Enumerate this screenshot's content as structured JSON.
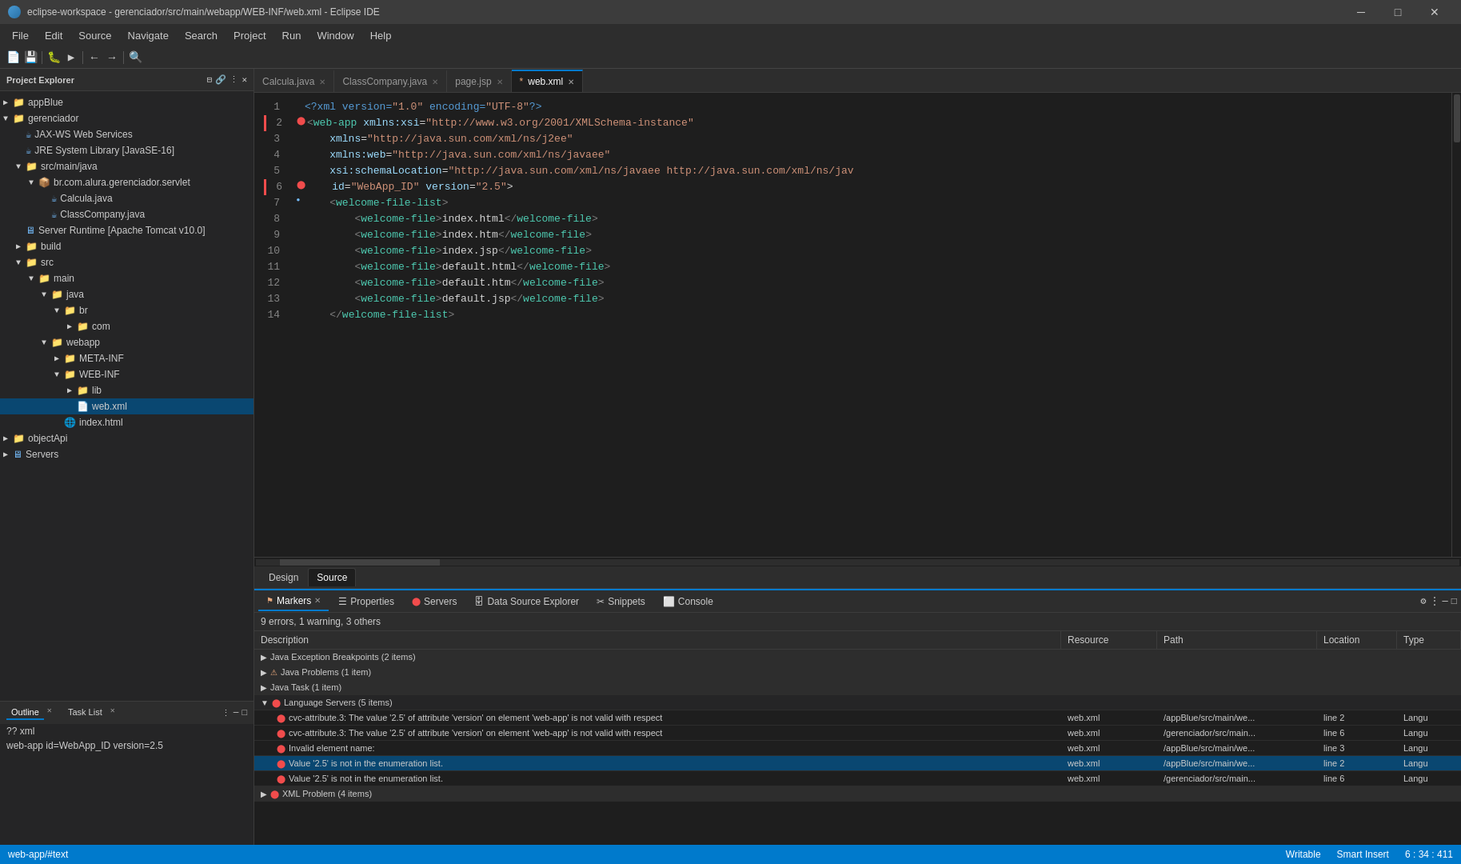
{
  "titleBar": {
    "icon": "eclipse-icon",
    "title": "eclipse-workspace - gerenciador/src/main/webapp/WEB-INF/web.xml - Eclipse IDE",
    "minimize": "─",
    "maximize": "□",
    "close": "✕"
  },
  "menuBar": {
    "items": [
      "File",
      "Edit",
      "Source",
      "Navigate",
      "Search",
      "Project",
      "Run",
      "Window",
      "Help"
    ]
  },
  "editorTabs": [
    {
      "label": "Calcula.java",
      "active": false,
      "modified": false
    },
    {
      "label": "ClassCompany.java",
      "active": false,
      "modified": false
    },
    {
      "label": "page.jsp",
      "active": false,
      "modified": false
    },
    {
      "label": "*web.xml",
      "active": true,
      "modified": true
    }
  ],
  "designerTabs": [
    {
      "label": "Design",
      "active": false
    },
    {
      "label": "Source",
      "active": true
    }
  ],
  "codeLines": [
    {
      "num": 1,
      "code": "<?xml version=\"1.0\" encoding=\"UTF-8\"?>",
      "type": "decl",
      "gutter": ""
    },
    {
      "num": 2,
      "code": "<web-app xmlns:xsi=\"http://www.w3.org/2001/XMLSchema-instance\"",
      "type": "tag",
      "gutter": "error"
    },
    {
      "num": 3,
      "code": "    xmlns=\"http://java.sun.com/xml/ns/j2ee\"",
      "type": "attr",
      "gutter": ""
    },
    {
      "num": 4,
      "code": "    xmlns:web=\"http://java.sun.com/xml/ns/javaee\"",
      "type": "attr",
      "gutter": ""
    },
    {
      "num": 5,
      "code": "    xsi:schemaLocation=\"http://java.sun.com/xml/ns/javaee  http://java.sun.com/xml/ns/jav",
      "type": "attr",
      "gutter": ""
    },
    {
      "num": 6,
      "code": "    id=\"WebApp_ID\"  version=\"2.5\">",
      "type": "attr",
      "gutter": "error"
    },
    {
      "num": 7,
      "code": "    <welcome-file-list>",
      "type": "tag",
      "gutter": "dot"
    },
    {
      "num": 8,
      "code": "        <welcome-file>index.html</welcome-file>",
      "type": "tag",
      "gutter": ""
    },
    {
      "num": 9,
      "code": "        <welcome-file>index.htm</welcome-file>",
      "type": "tag",
      "gutter": ""
    },
    {
      "num": 10,
      "code": "        <welcome-file>index.jsp</welcome-file>",
      "type": "tag",
      "gutter": ""
    },
    {
      "num": 11,
      "code": "        <welcome-file>default.html</welcome-file>",
      "type": "tag",
      "gutter": ""
    },
    {
      "num": 12,
      "code": "        <welcome-file>default.htm</welcome-file>",
      "type": "tag",
      "gutter": ""
    },
    {
      "num": 13,
      "code": "        <welcome-file>default.jsp</welcome-file>",
      "type": "tag",
      "gutter": ""
    },
    {
      "num": 14,
      "code": "    </welcome-file-list>",
      "type": "tag",
      "gutter": ""
    }
  ],
  "projectExplorer": {
    "title": "Project Explorer",
    "closeBtn": "✕",
    "items": [
      {
        "label": "appBlue",
        "level": 0,
        "type": "project",
        "expanded": false
      },
      {
        "label": "gerenciador",
        "level": 0,
        "type": "project",
        "expanded": true
      },
      {
        "label": "JAX-WS Web Services",
        "level": 1,
        "type": "jar",
        "expanded": false
      },
      {
        "label": "JRE System Library [JavaSE-16]",
        "level": 1,
        "type": "jar",
        "expanded": false
      },
      {
        "label": "src/main/java",
        "level": 1,
        "type": "folder",
        "expanded": true
      },
      {
        "label": "br.com.alura.gerenciador.servlet",
        "level": 2,
        "type": "package",
        "expanded": true
      },
      {
        "label": "Calcula.java",
        "level": 3,
        "type": "java",
        "expanded": false
      },
      {
        "label": "ClassCompany.java",
        "level": 3,
        "type": "java",
        "expanded": false
      },
      {
        "label": "Server Runtime [Apache Tomcat v10.0]",
        "level": 1,
        "type": "server",
        "expanded": false
      },
      {
        "label": "build",
        "level": 1,
        "type": "folder",
        "expanded": false
      },
      {
        "label": "src",
        "level": 1,
        "type": "folder",
        "expanded": true
      },
      {
        "label": "main",
        "level": 2,
        "type": "folder",
        "expanded": true
      },
      {
        "label": "java",
        "level": 3,
        "type": "folder",
        "expanded": true
      },
      {
        "label": "br",
        "level": 4,
        "type": "folder",
        "expanded": true
      },
      {
        "label": "com",
        "level": 5,
        "type": "folder",
        "expanded": false
      },
      {
        "label": "webapp",
        "level": 3,
        "type": "folder",
        "expanded": true
      },
      {
        "label": "META-INF",
        "level": 4,
        "type": "folder",
        "expanded": false
      },
      {
        "label": "WEB-INF",
        "level": 4,
        "type": "folder",
        "expanded": true
      },
      {
        "label": "lib",
        "level": 5,
        "type": "folder",
        "expanded": false
      },
      {
        "label": "web.xml",
        "level": 5,
        "type": "xml",
        "expanded": false
      },
      {
        "label": "index.html",
        "level": 4,
        "type": "html",
        "expanded": false
      },
      {
        "label": "objectApi",
        "level": 0,
        "type": "project",
        "expanded": false
      },
      {
        "label": "Servers",
        "level": 0,
        "type": "project",
        "expanded": false
      }
    ]
  },
  "outline": {
    "title": "Outline",
    "taskListTitle": "Task List",
    "closeBtn": "✕",
    "items": [
      {
        "label": "?? xml",
        "level": 0
      },
      {
        "label": "web-app id=WebApp_ID version=2.5",
        "level": 0
      }
    ]
  },
  "problemsPanel": {
    "summary": "9 errors, 1 warning, 3 others",
    "tabs": [
      {
        "label": "Markers",
        "active": true,
        "closeable": true
      },
      {
        "label": "Properties",
        "active": false
      },
      {
        "label": "Servers",
        "active": false
      },
      {
        "label": "Data Source Explorer",
        "active": false
      },
      {
        "label": "Snippets",
        "active": false
      },
      {
        "label": "Console",
        "active": false
      }
    ],
    "columns": [
      "Description",
      "Resource",
      "Path",
      "Location",
      "Type"
    ],
    "categories": [
      {
        "label": "Java Exception Breakpoints (2 items)",
        "expanded": false,
        "type": "info"
      },
      {
        "label": "Java Problems (1 item)",
        "expanded": false,
        "type": "warning"
      },
      {
        "label": "Java Task (1 item)",
        "expanded": false,
        "type": "info"
      },
      {
        "label": "Language Servers (5 items)",
        "expanded": true,
        "type": "error"
      }
    ],
    "rows": [
      {
        "desc": "cvc-attribute.3: The value '2.5' of attribute 'version' on element 'web-app' is not valid with respect",
        "resource": "web.xml",
        "path": "/appBlue/src/main/we...",
        "location": "line 2",
        "type": "Langu"
      },
      {
        "desc": "cvc-attribute.3: The value '2.5' of attribute 'version' on element 'web-app' is not valid with respect",
        "resource": "web.xml",
        "path": "/gerenciador/src/main...",
        "location": "line 6",
        "type": "Langu"
      },
      {
        "desc": "Invalid element name:",
        "resource": "web.xml",
        "path": "/appBlue/src/main/we...",
        "location": "line 3",
        "type": "Langu"
      },
      {
        "desc": "Value '2.5' is not in the enumeration list.",
        "resource": "web.xml",
        "path": "/appBlue/src/main/we...",
        "location": "line 2",
        "type": "Langu"
      },
      {
        "desc": "Value '2.5' is not in the enumeration list.",
        "resource": "web.xml",
        "path": "/gerenciador/src/main...",
        "location": "line 6",
        "type": "Langu"
      },
      {
        "desc": "XML Problem (4 items)",
        "resource": "",
        "path": "",
        "location": "",
        "type": ""
      }
    ]
  },
  "statusBar": {
    "left": "web-app/#text",
    "writeable": "Writable",
    "insertMode": "Smart Insert",
    "position": "6 : 34 : 411"
  }
}
